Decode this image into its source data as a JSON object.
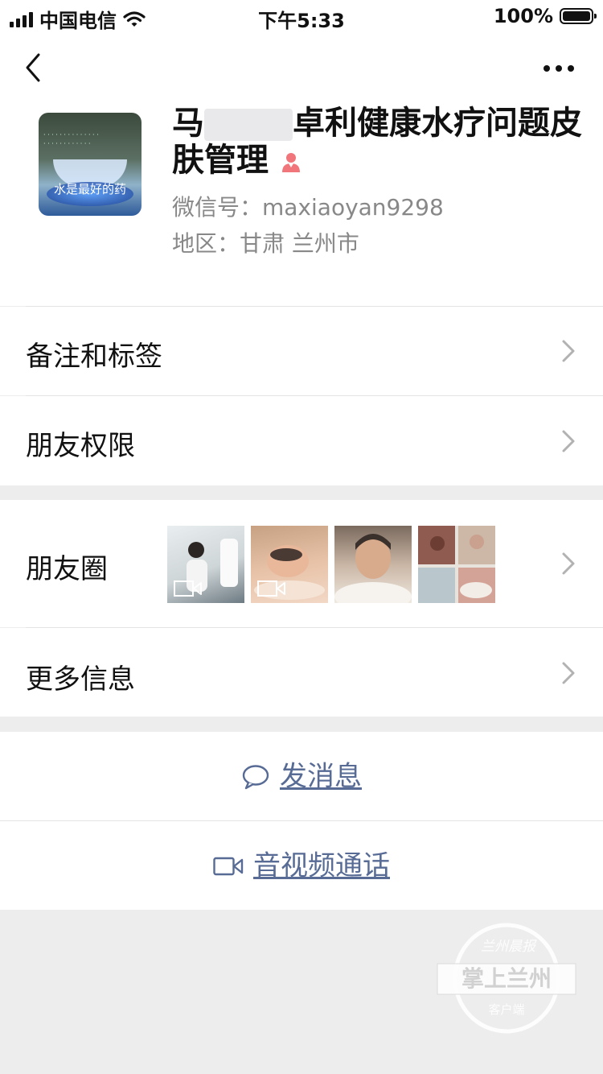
{
  "status_bar": {
    "carrier": "中国电信",
    "time": "下午5:33",
    "battery": "100%"
  },
  "profile": {
    "name_prefix": "马",
    "name_suffix": "卓利健康水疗问题皮肤管理",
    "wechat_id": "微信号：maxiaoyan9298",
    "region": "地区：甘肃 兰州市",
    "avatar_caption": "水是最好的药"
  },
  "menu": {
    "remarks": "备注和标签",
    "permissions": "朋友权限",
    "moments": "朋友圈",
    "more_info": "更多信息"
  },
  "actions": {
    "message": "发消息",
    "call": "音视频通话"
  },
  "colors": {
    "link": "#576b95",
    "background": "#ededed",
    "female_icon": "#f0767b"
  }
}
